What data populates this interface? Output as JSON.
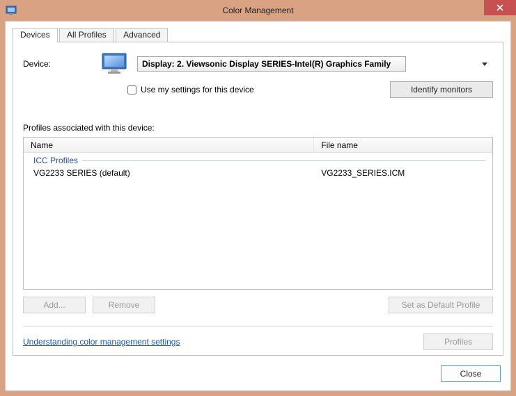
{
  "window": {
    "title": "Color Management"
  },
  "tabs": [
    {
      "label": "Devices",
      "active": true
    },
    {
      "label": "All Profiles",
      "active": false
    },
    {
      "label": "Advanced",
      "active": false
    }
  ],
  "device": {
    "label": "Device:",
    "selected": "Display: 2. Viewsonic Display SERIES-Intel(R) Graphics Family",
    "use_settings_label": "Use my settings for this device",
    "identify_label": "Identify monitors"
  },
  "profiles": {
    "caption": "Profiles associated with this device:",
    "columns": {
      "name": "Name",
      "file": "File name"
    },
    "group": "ICC Profiles",
    "rows": [
      {
        "name": "VG2233 SERIES (default)",
        "file": "VG2233_SERIES.ICM"
      }
    ]
  },
  "buttons": {
    "add": "Add...",
    "remove": "Remove",
    "set_default": "Set as Default Profile",
    "profiles_btn": "Profiles",
    "close": "Close"
  },
  "link": {
    "understand": "Understanding color management settings"
  }
}
